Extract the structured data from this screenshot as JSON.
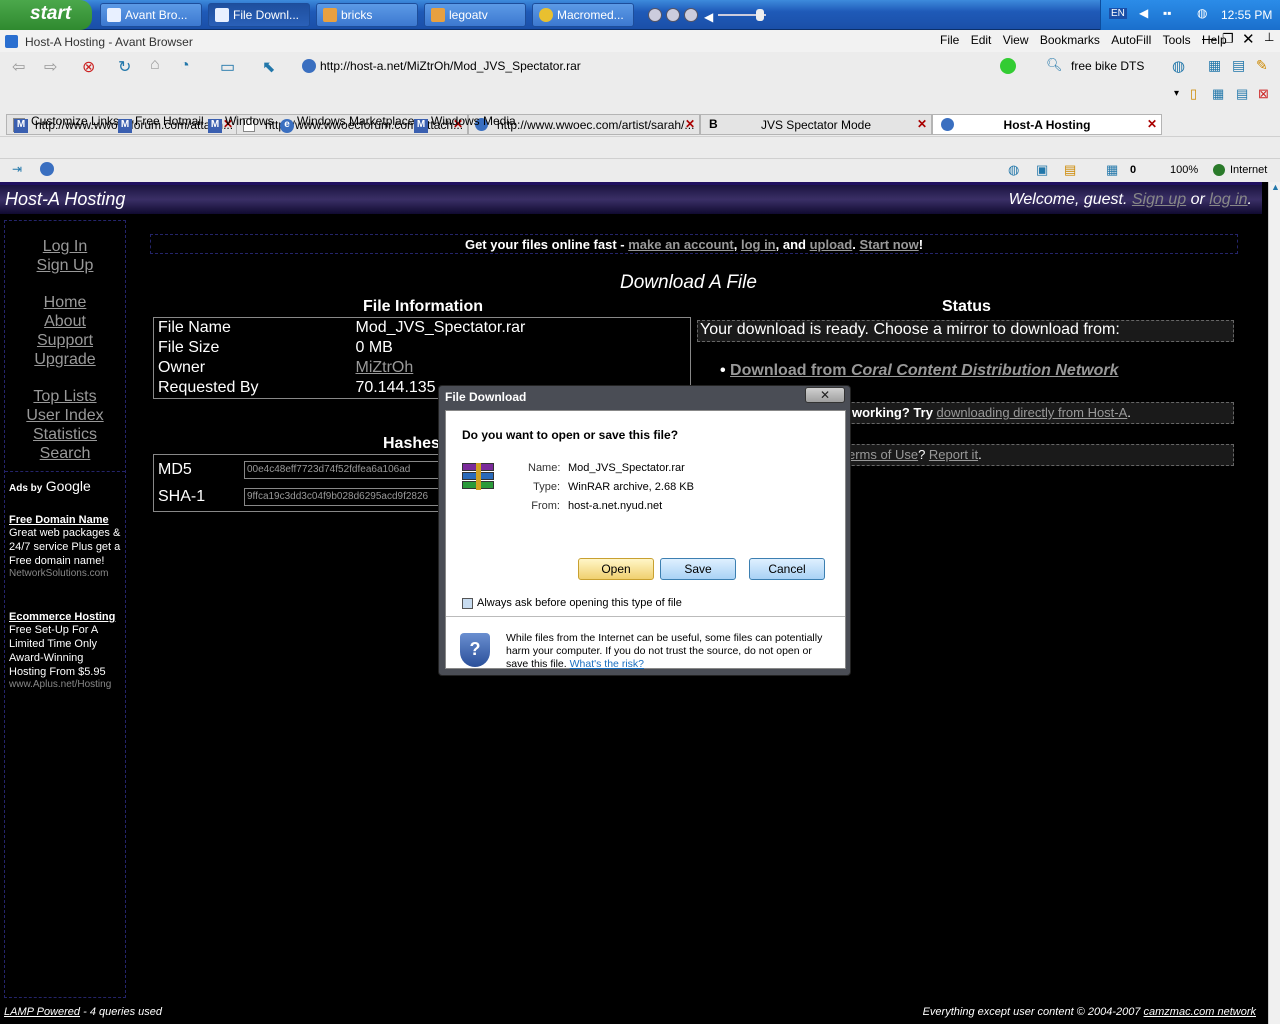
{
  "taskbar": {
    "start_label": "start",
    "buttons": [
      "Avant Bro...",
      "File Downl...",
      "bricks",
      "legoatv",
      "Macromed..."
    ],
    "lang": "EN",
    "clock": "12:55 PM"
  },
  "browser": {
    "title": "Host-A Hosting - Avant Browser",
    "menu": [
      "File",
      "Edit",
      "View",
      "Bookmarks",
      "AutoFill",
      "Tools",
      "Help"
    ],
    "address": "http://host-a.net/MiZtrOh/Mod_JVS_Spectator.rar",
    "search_text": "free bike DTS",
    "tabs": [
      "http://www.wwoecforum.com/attach...",
      "http://www.wwoecforum.com/attach...",
      "http://www.wwoec.com/artist/sarah/...",
      "JVS Spectator Mode",
      "Host-A Hosting"
    ],
    "links": [
      "Customize Links",
      "Free Hotmail",
      "Windows",
      "Windows Marketplace",
      "Windows Media"
    ],
    "status_count": "0",
    "zoom": "100%",
    "zone": "Internet"
  },
  "site": {
    "title": "Host-A Hosting",
    "welcome_prefix": "Welcome, guest.",
    "signup": "Sign up",
    "or": "or",
    "login": "log in",
    "nav": {
      "login": "Log In",
      "signup": "Sign Up",
      "home": "Home",
      "about": "About",
      "support": "Support",
      "upgrade": "Upgrade",
      "toplists": "Top Lists",
      "userindex": "User Index",
      "statistics": "Statistics",
      "search": "Search"
    },
    "ads_by": "Ads by",
    "google": "Google",
    "ads": [
      {
        "title": "Free Domain Name",
        "body": "Great web packages & 24/7 service Plus get a Free domain name!",
        "url": "NetworkSolutions.com"
      },
      {
        "title": "Ecommerce Hosting",
        "body": "Free Set-Up For A Limited Time Only Award-Winning Hosting From $5.95",
        "url": "www.Aplus.net/Hosting"
      }
    ],
    "banner": {
      "text1": "Get your files online fast -",
      "make": "make an account",
      "comma": ",",
      "login": "log in",
      "and": ", and",
      "upload": "upload",
      "dot": ".",
      "start": "Start now",
      "excl": "!"
    },
    "heading": "Download A File",
    "file_info_heading": "File Information",
    "file_info": [
      {
        "k": "File Name",
        "v": "Mod_JVS_Spectator.rar"
      },
      {
        "k": "File Size",
        "v": "0 MB"
      },
      {
        "k": "Owner",
        "v": "MiZtrOh"
      },
      {
        "k": "Requested By",
        "v": "70.144.135"
      }
    ],
    "hashes_heading": "Hashes",
    "md5_label": "MD5",
    "md5": "00e4c48eff7723d74f52fdfea6a106ad",
    "sha1_label": "SHA-1",
    "sha1": "9ffca19c3dd3c04f9b028d6295acd9f2826",
    "status_heading": "Status",
    "status_text": "Your download is ready. Choose a mirror to download from:",
    "mirror_prefix": "Download from",
    "mirror_name": "Coral Content Distribution Network",
    "notworking": "working?",
    "try": "Try",
    "direct": "downloading directly from Host-A",
    "terms": "erms of Use",
    "report": "Report it",
    "footer_left_link": "LAMP Powered",
    "footer_left_rest": "- 4 queries used",
    "footer_right": "Everything except user content © 2004-2007",
    "footer_right_link": "camzmac.com network"
  },
  "dialog": {
    "title": "File Download",
    "question": "Do you want to open or save this file?",
    "name_label": "Name:",
    "name": "Mod_JVS_Spectator.rar",
    "type_label": "Type:",
    "type": "WinRAR archive, 2.68 KB",
    "from_label": "From:",
    "from": "host-a.net.nyud.net",
    "open": "Open",
    "save": "Save",
    "cancel": "Cancel",
    "always_ask": "Always ask before opening this type of file",
    "warning": "While files from the Internet can be useful, some files can potentially harm your computer. If you do not trust the source, do not open or save this file.",
    "risk": "What's the risk?"
  }
}
